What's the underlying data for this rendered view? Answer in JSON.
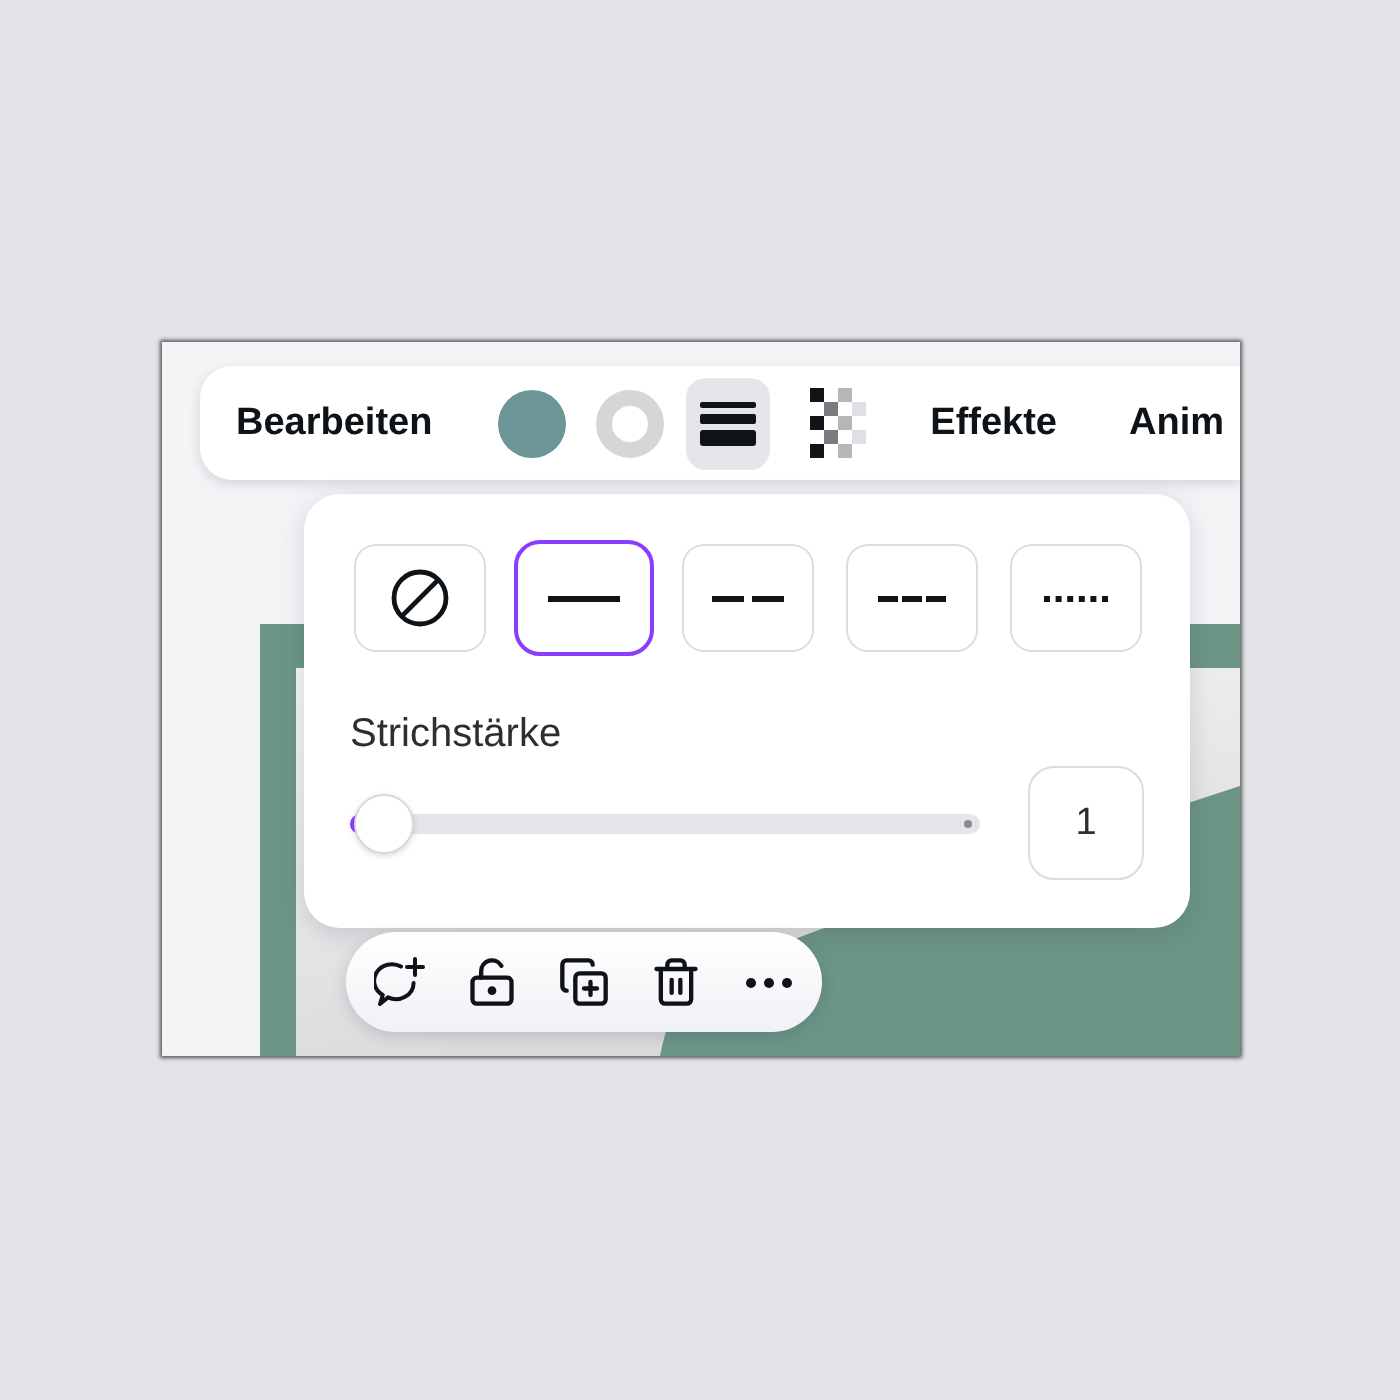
{
  "toolbar": {
    "items": [
      {
        "kind": "text",
        "label": "Bearbeiten",
        "selected": false
      },
      {
        "kind": "fill-color",
        "color": "#6b9597",
        "selected": false
      },
      {
        "kind": "border-color",
        "selected": false
      },
      {
        "kind": "line-style",
        "selected": true
      },
      {
        "kind": "transparency",
        "selected": false
      },
      {
        "kind": "text",
        "label": "Effekte",
        "selected": false
      },
      {
        "kind": "text",
        "label": "Anim",
        "selected": false
      }
    ]
  },
  "line_style_panel": {
    "styles": [
      {
        "kind": "none",
        "selected": false
      },
      {
        "kind": "solid",
        "selected": true
      },
      {
        "kind": "dashed",
        "selected": false
      },
      {
        "kind": "short-dashed",
        "selected": false
      },
      {
        "kind": "dotted",
        "selected": false
      }
    ],
    "stroke_width": {
      "label": "Strichstärke",
      "level": 0,
      "value": "1"
    }
  },
  "action_bar": {
    "actions": [
      {
        "kind": "comment"
      },
      {
        "kind": "lock"
      },
      {
        "kind": "duplicate"
      },
      {
        "kind": "delete"
      },
      {
        "kind": "more"
      }
    ]
  }
}
